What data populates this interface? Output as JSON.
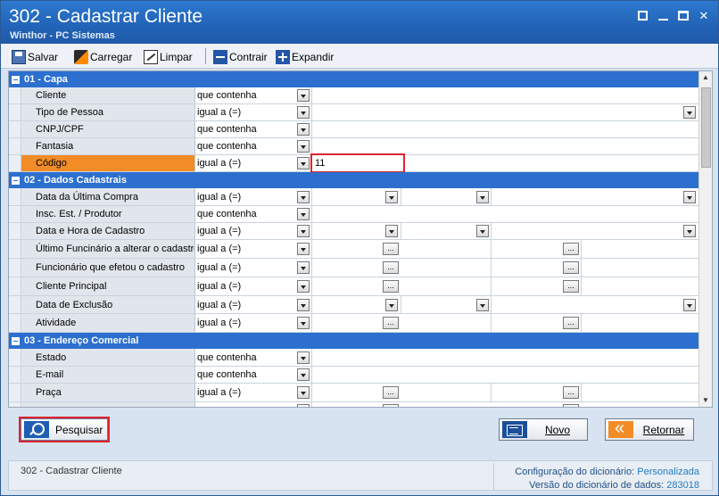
{
  "window": {
    "title": "302 - Cadastrar Cliente",
    "subtitle": "Winthor - PC Sistemas"
  },
  "toolbar": {
    "save_label": "Salvar",
    "load_label": "Carregar",
    "clear_label": "Limpar",
    "collapse_label": "Contrair",
    "expand_label": "Expandir"
  },
  "sections": [
    {
      "title": "01 - Capa",
      "rows": [
        {
          "label": "Cliente",
          "operator": "que contenha"
        },
        {
          "label": "Tipo de Pessoa",
          "operator": "igual a (=)"
        },
        {
          "label": "CNPJ/CPF",
          "operator": "que contenha"
        },
        {
          "label": "Fantasia",
          "operator": "que contenha"
        },
        {
          "label": "Código",
          "operator": "igual a (=)",
          "value": "11"
        }
      ]
    },
    {
      "title": "02 - Dados Cadastrais",
      "rows": [
        {
          "label": "Data da Última Compra",
          "operator": "igual a (=)"
        },
        {
          "label": "Insc. Est. / Produtor",
          "operator": "que contenha"
        },
        {
          "label": "Data e Hora de Cadastro",
          "operator": "igual a (=)"
        },
        {
          "label": "Último Funcinário a alterar o cadastro",
          "operator": "igual a (=)"
        },
        {
          "label": "Funcionário que efetou o cadastro",
          "operator": "igual a (=)"
        },
        {
          "label": "Cliente Principal",
          "operator": "igual a (=)"
        },
        {
          "label": "Data de Exclusão",
          "operator": "igual a (=)"
        },
        {
          "label": "Atividade",
          "operator": "igual a (=)"
        }
      ]
    },
    {
      "title": "03 - Endereço Comercial",
      "rows": [
        {
          "label": "Estado",
          "operator": "que contenha"
        },
        {
          "label": "E-mail",
          "operator": "que contenha"
        },
        {
          "label": "Praça",
          "operator": "igual a (=)"
        }
      ]
    }
  ],
  "buttons": {
    "search": "Pesquisar",
    "new": "Novo",
    "back": "Retornar"
  },
  "status": {
    "left": "302 - Cadastrar Cliente",
    "dict_config_label": "Configuração do dicionário:",
    "dict_config_value": "Personalizada",
    "dict_version_label": "Versão do dicionário de dados:",
    "dict_version_value": "283018"
  },
  "icons": {
    "save": "save-icon",
    "load": "load-icon",
    "clear": "clear-icon",
    "collapse": "collapse-icon",
    "expand": "expand-icon",
    "search": "search-icon",
    "new": "new-icon",
    "back": "back-icon"
  },
  "colors": {
    "title_bar": "#2263b7",
    "section_header": "#2c6fcf",
    "active_row": "#f28c26",
    "highlight": "#e0232f"
  }
}
